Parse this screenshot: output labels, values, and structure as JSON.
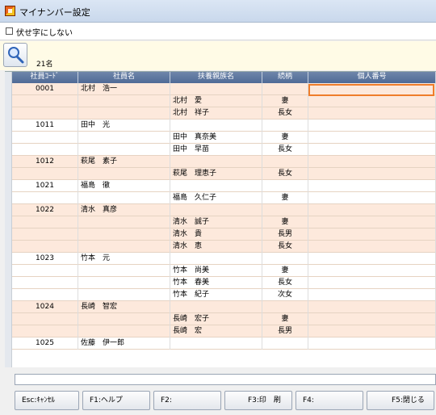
{
  "window": {
    "title": "マイナンバー設定"
  },
  "options": {
    "hide_label": "伏せ字にしない",
    "hide_checked": false
  },
  "search": {
    "count_text": "21名"
  },
  "table": {
    "headers": [
      "社員ｺｰﾄﾞ",
      "社員名",
      "扶養親族名",
      "続柄",
      "個人番号"
    ],
    "rows": [
      {
        "code": "0001",
        "employee": "北村　浩一",
        "dependent": "",
        "relation": "",
        "number": ""
      },
      {
        "code": "",
        "employee": "",
        "dependent": "北村　愛",
        "relation": "妻",
        "number": ""
      },
      {
        "code": "",
        "employee": "",
        "dependent": "北村　祥子",
        "relation": "長女",
        "number": ""
      },
      {
        "code": "1011",
        "employee": "田中　光",
        "dependent": "",
        "relation": "",
        "number": ""
      },
      {
        "code": "",
        "employee": "",
        "dependent": "田中　真奈美",
        "relation": "妻",
        "number": ""
      },
      {
        "code": "",
        "employee": "",
        "dependent": "田中　早苗",
        "relation": "長女",
        "number": ""
      },
      {
        "code": "1012",
        "employee": "萩尾　素子",
        "dependent": "",
        "relation": "",
        "number": ""
      },
      {
        "code": "",
        "employee": "",
        "dependent": "萩尾　理恵子",
        "relation": "長女",
        "number": ""
      },
      {
        "code": "1021",
        "employee": "福島　徹",
        "dependent": "",
        "relation": "",
        "number": ""
      },
      {
        "code": "",
        "employee": "",
        "dependent": "福島　久仁子",
        "relation": "妻",
        "number": ""
      },
      {
        "code": "1022",
        "employee": "清水　真彦",
        "dependent": "",
        "relation": "",
        "number": ""
      },
      {
        "code": "",
        "employee": "",
        "dependent": "清水　誠子",
        "relation": "妻",
        "number": ""
      },
      {
        "code": "",
        "employee": "",
        "dependent": "清水　貴",
        "relation": "長男",
        "number": ""
      },
      {
        "code": "",
        "employee": "",
        "dependent": "清水　恵",
        "relation": "長女",
        "number": ""
      },
      {
        "code": "1023",
        "employee": "竹本　元",
        "dependent": "",
        "relation": "",
        "number": ""
      },
      {
        "code": "",
        "employee": "",
        "dependent": "竹本　尚美",
        "relation": "妻",
        "number": ""
      },
      {
        "code": "",
        "employee": "",
        "dependent": "竹本　春美",
        "relation": "長女",
        "number": ""
      },
      {
        "code": "",
        "employee": "",
        "dependent": "竹本　紀子",
        "relation": "次女",
        "number": ""
      },
      {
        "code": "1024",
        "employee": "長崎　智宏",
        "dependent": "",
        "relation": "",
        "number": ""
      },
      {
        "code": "",
        "employee": "",
        "dependent": "長崎　宏子",
        "relation": "妻",
        "number": ""
      },
      {
        "code": "",
        "employee": "",
        "dependent": "長崎　宏",
        "relation": "長男",
        "number": ""
      },
      {
        "code": "1025",
        "employee": "佐藤　伊一郎",
        "dependent": "",
        "relation": "",
        "number": ""
      }
    ]
  },
  "fkeys": {
    "esc": "Esc:ｷｬﾝｾﾙ",
    "f1": "F1:ヘルプ",
    "f2": "F2:",
    "f3": "F3:印　刷",
    "f4": "F4:",
    "f5": "F5:閉じる"
  },
  "colors": {
    "header": "#5b75a0",
    "group_row": "#fde9dc",
    "focus": "#ef7d2a"
  },
  "icons": {
    "app": "app-icon",
    "search": "search-icon"
  }
}
